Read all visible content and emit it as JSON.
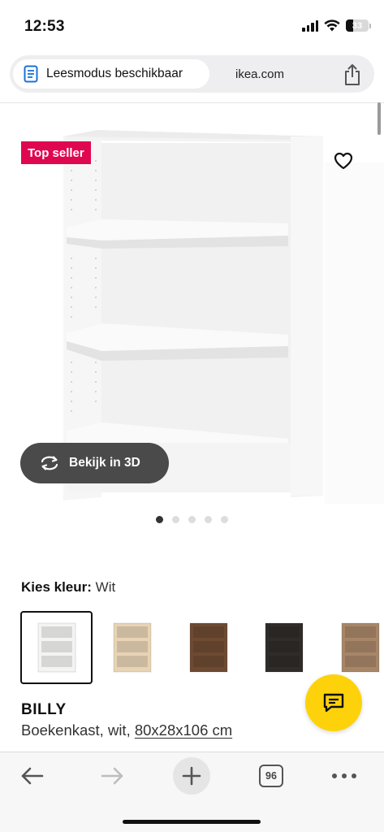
{
  "status_bar": {
    "time": "12:53",
    "battery": "33",
    "battery_level": 0.33
  },
  "address_bar": {
    "reader_label": "Leesmodus beschikbaar",
    "domain": "ikea.com"
  },
  "product_image": {
    "badge": "Top seller",
    "view_3d_label": "Bekijk in 3D",
    "dot_count": 5,
    "active_dot": 0
  },
  "color": {
    "label": "Kies kleur:",
    "value": "Wit",
    "swatches": [
      {
        "name": "wit",
        "color": "#f4f4f2"
      },
      {
        "name": "eikenfineer",
        "color": "#e8d3b5"
      },
      {
        "name": "bruin",
        "color": "#6e4a33"
      },
      {
        "name": "zwartbruin",
        "color": "#2f2c2a"
      },
      {
        "name": "eiken",
        "color": "#a78668"
      }
    ]
  },
  "product": {
    "name": "BILLY",
    "description": "Boekenkast, wit, ",
    "dimensions": "80x28x106 cm"
  },
  "toolbar": {
    "tab_count": "96"
  },
  "colors": {
    "badge": "#e00751",
    "chat": "#fdd20b",
    "view3d": "#4a4a4a"
  }
}
